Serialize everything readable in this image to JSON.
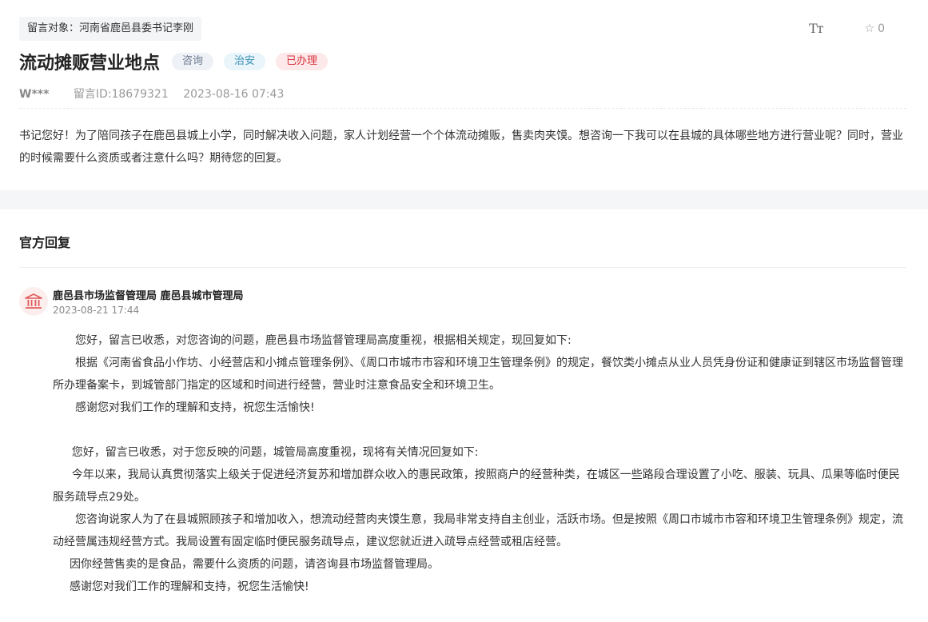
{
  "header": {
    "target_label": "留言对象：河南省鹿邑县委书记李刚",
    "font_tool": "Tт",
    "favorite_count": "0",
    "title": "流动摊贩营业地点",
    "tags": [
      "咨询",
      "治安",
      "已办理"
    ],
    "user": "W***",
    "message_id": "留言ID:18679321",
    "time": "2023-08-16 07:43"
  },
  "message": {
    "content": "书记您好！为了陪同孩子在鹿邑县城上小学，同时解决收入问题，家人计划经营一个个体流动摊贩，售卖肉夹馍。想咨询一下我可以在县城的具体哪些地方进行营业呢？同时，营业的时候需要什么资质或者注意什么吗？期待您的回复。"
  },
  "reply": {
    "section_title": "官方回复",
    "department": "鹿邑县市场监督管理局 鹿邑县城市管理局",
    "time": "2023-08-21 17:44",
    "paragraphs": [
      "您好，留言已收悉，对您咨询的问题，鹿邑县市场监督管理局高度重视，根据相关规定，现回复如下:",
      "根据《河南省食品小作坊、小经营店和小摊点管理条例》、《周口市城市市容和环境卫生管理条例》的规定，餐饮类小摊点从业人员凭身份证和健康证到辖区市场监督管理所办理备案卡，到城管部门指定的区域和时间进行经营，营业时注意食品安全和环境卫生。",
      "感谢您对我们工作的理解和支持，祝您生活愉快!",
      "",
      "您好，留言已收悉，对于您反映的问题，城管局高度重视，现将有关情况回复如下:",
      "今年以来，我局认真贯彻落实上级关于促进经济复苏和增加群众收入的惠民政策，按照商户的经营种类，在城区一些路段合理设置了小吃、服装、玩具、瓜果等临时便民服务疏导点29处。",
      "您咨询说家人为了在县城照顾孩子和增加收入，想流动经营肉夹馍生意，我局非常支持自主创业，活跃市场。但是按照《周口市城市市容和环境卫生管理条例》规定，流动经营属违规经营方式。我局设置有固定临时便民服务疏导点，建议您就近进入疏导点经营或租店经营。",
      "因你经营售卖的是食品，需要什么资质的问题，请咨询县市场监督管理局。",
      "感谢您对我们工作的理解和支持，祝您生活愉快!"
    ]
  },
  "colors": {
    "tag_consult": "#6d7a8f",
    "tag_security": "#3a8fb5",
    "tag_done": "#d9363e",
    "avatar_icon": "#e05a5a"
  },
  "icons": {
    "font_size": "font-size-icon",
    "favorite": "star-outline-icon",
    "department": "government-building-icon"
  }
}
